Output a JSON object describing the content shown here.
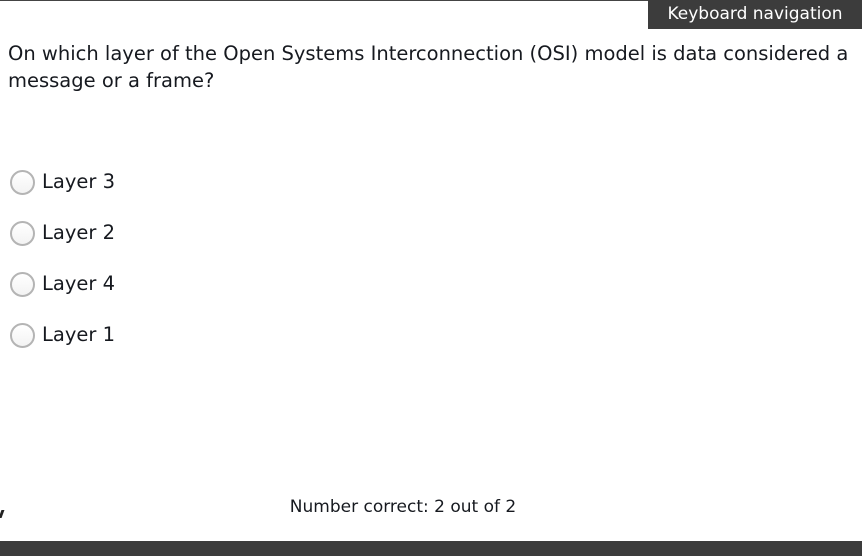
{
  "header": {
    "keyboard_nav_label": "Keyboard navigation"
  },
  "quiz": {
    "question": "On which layer of the Open Systems Interconnection (OSI) model is data considered a message or a frame?",
    "options": [
      {
        "label": "Layer 3",
        "selected": false
      },
      {
        "label": "Layer 2",
        "selected": false
      },
      {
        "label": "Layer 4",
        "selected": false
      },
      {
        "label": "Layer 1",
        "selected": false
      }
    ],
    "score_text": "Number correct: 2 out of 2"
  }
}
